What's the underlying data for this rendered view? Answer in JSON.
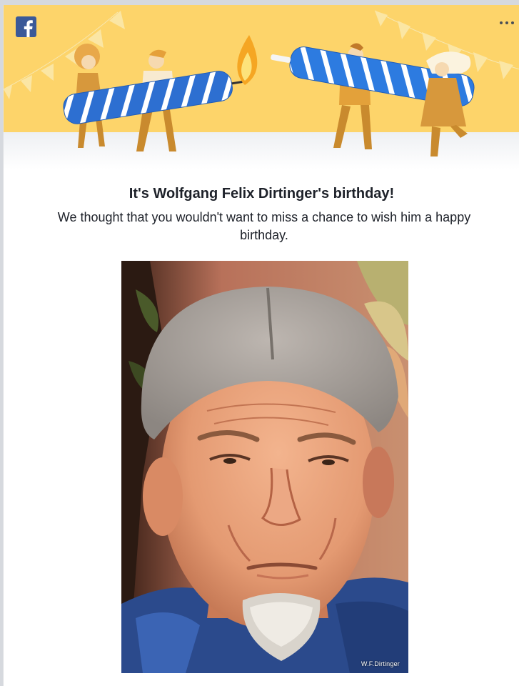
{
  "brand": {
    "name": "Facebook",
    "logo_icon": "facebook-f-icon",
    "color": "#3b5998"
  },
  "header": {
    "menu_icon": "more-horizontal-icon",
    "banner_color": "#fdd46a"
  },
  "notification": {
    "heading": "It's Wolfgang Felix Dirtinger's birthday!",
    "message": "We thought that you wouldn't want to miss a chance to wish him a happy birthday."
  },
  "photo": {
    "watermark": "W.F.Dirtinger",
    "subject": "profile-photo"
  },
  "colors": {
    "candle_blue": "#2d6fd1",
    "flame_orange": "#f5a623",
    "text_dark": "#1d2129"
  }
}
